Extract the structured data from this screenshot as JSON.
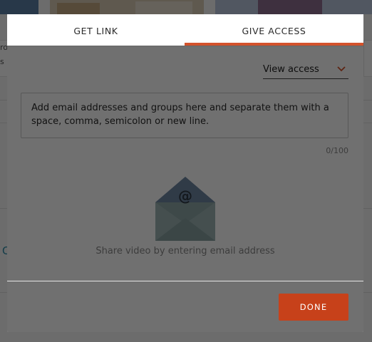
{
  "background": {
    "fragments": [
      "ro",
      "s",
      "C"
    ]
  },
  "modal": {
    "tabs": [
      {
        "label": "GET LINK",
        "active": false
      },
      {
        "label": "GIVE ACCESS",
        "active": true
      }
    ],
    "accent_color": "#d4532c",
    "permission": {
      "selected": "View access",
      "icon": "chevron-down-icon"
    },
    "email_input": {
      "placeholder": "Add email addresses and groups here and separate them with a space, comma, semicolon or new line.",
      "char_count": "0/100"
    },
    "empty_state": {
      "icon": "envelope-at-icon",
      "text": "Share video by entering email address"
    },
    "done_label": "DONE",
    "done_color": "#c7411a"
  }
}
